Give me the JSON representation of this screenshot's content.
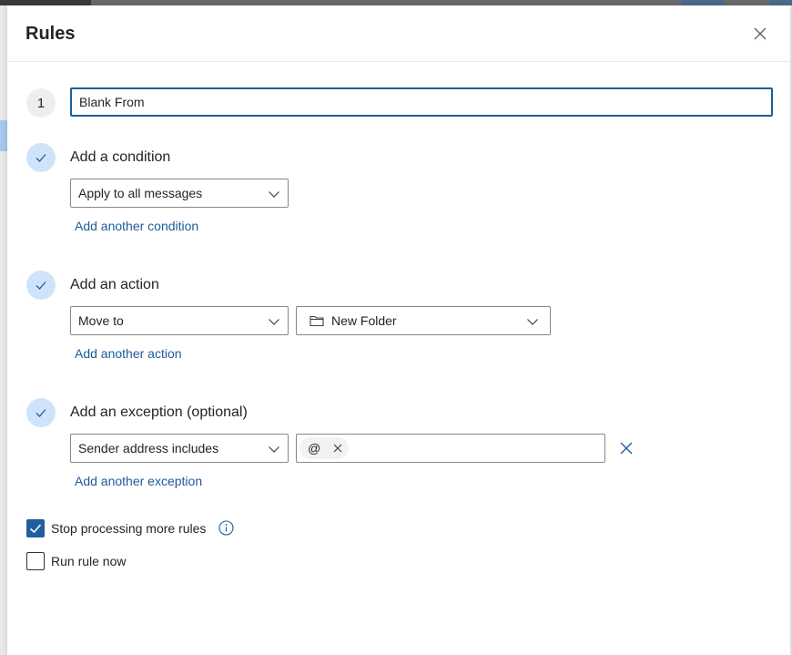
{
  "dialog": {
    "title": "Rules",
    "close_icon": "close-icon"
  },
  "rule": {
    "step_number": "1",
    "name_value": "Blank From"
  },
  "condition": {
    "label": "Add a condition",
    "selected": "Apply to all messages",
    "add_link": "Add another condition"
  },
  "action": {
    "label": "Add an action",
    "selected": "Move to",
    "folder_icon": "folder-icon",
    "folder": "New Folder",
    "add_link": "Add another action"
  },
  "exception": {
    "label": "Add an exception (optional)",
    "selected": "Sender address includes",
    "chip": "@",
    "add_link": "Add another exception"
  },
  "options": {
    "stop_processing": {
      "label": "Stop processing more rules",
      "checked": true
    },
    "run_now": {
      "label": "Run rule now",
      "checked": false
    }
  },
  "colors": {
    "accent": "#1f5f9f",
    "link": "#1e5a9c",
    "check_bg": "#cfe4fa"
  }
}
